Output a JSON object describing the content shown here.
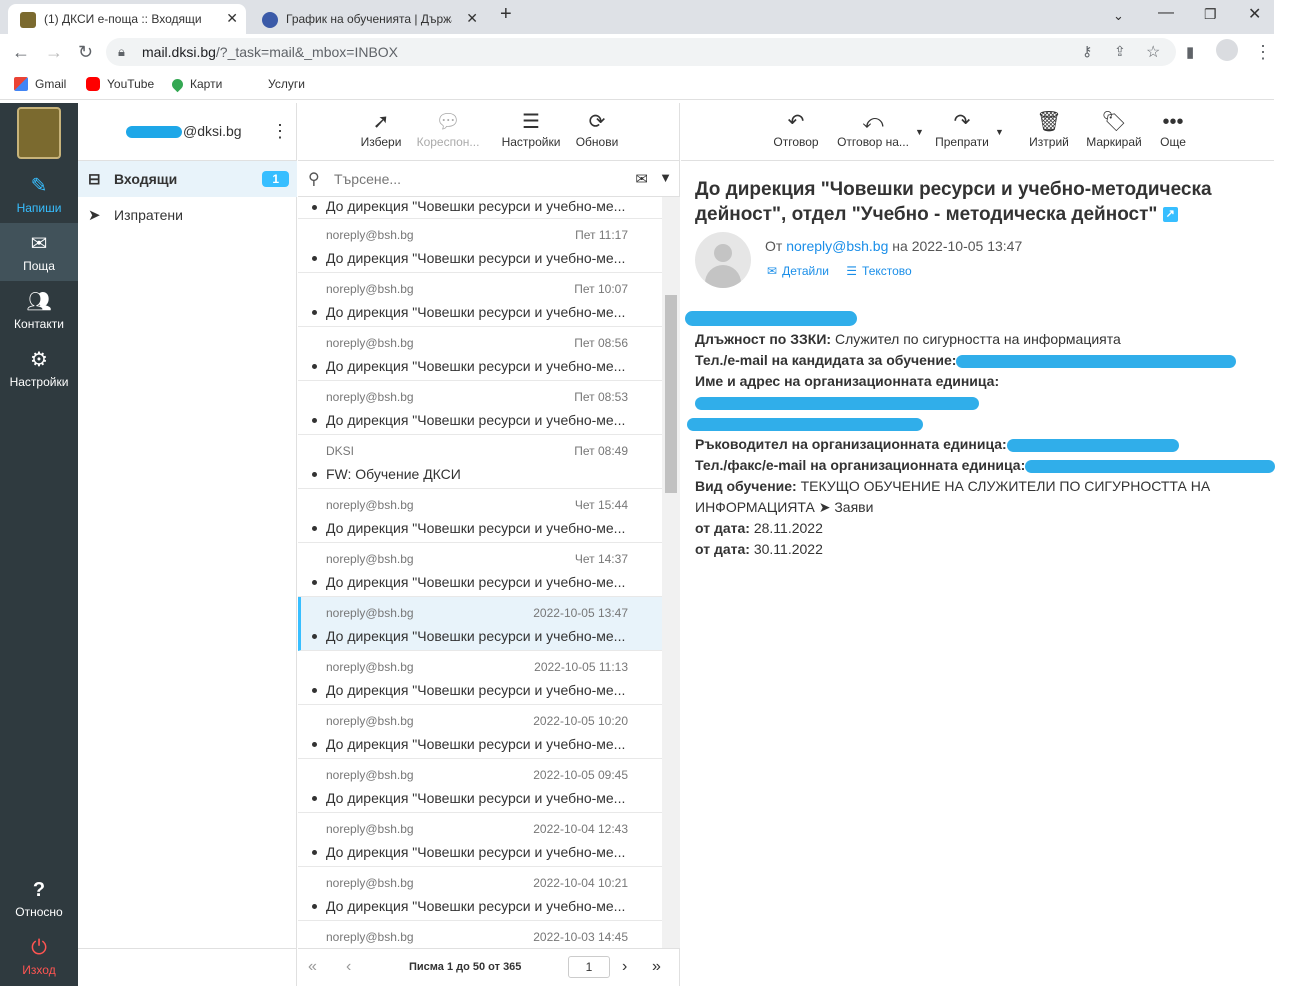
{
  "browser": {
    "tabs": [
      {
        "title": "(1) ДКСИ е-поща :: Входящи",
        "active": true
      },
      {
        "title": "График на обученията | Държав",
        "active": false
      }
    ],
    "new_tab": "+",
    "url_host": "mail.dksi.bg",
    "url_path": "/?_task=mail&_mbox=INBOX",
    "bookmarks": [
      "Gmail",
      "YouTube",
      "Карти",
      "Услуги"
    ]
  },
  "nav": {
    "compose": "Напиши",
    "mail": "Поща",
    "contacts": "Контакти",
    "settings": "Настройки",
    "about": "Относно",
    "logout": "Изход"
  },
  "folders": {
    "user_suffix": "@dksi.bg",
    "items": [
      {
        "label": "Входящи",
        "badge": "1"
      },
      {
        "label": "Изпратени"
      }
    ]
  },
  "list_toolbar": {
    "select": "Избери",
    "threads": "Кореспон...",
    "options": "Настройки",
    "refresh": "Обнови"
  },
  "search": {
    "placeholder": "Търсене..."
  },
  "messages_first_subject": "До дирекция \"Човешки ресурси и учебно-ме...",
  "messages": [
    {
      "from": "noreply@bsh.bg",
      "date": "Пет 11:17",
      "subject": "До дирекция \"Човешки ресурси и учебно-ме..."
    },
    {
      "from": "noreply@bsh.bg",
      "date": "Пет 10:07",
      "subject": "До дирекция \"Човешки ресурси и учебно-ме..."
    },
    {
      "from": "noreply@bsh.bg",
      "date": "Пет 08:56",
      "subject": "До дирекция \"Човешки ресурси и учебно-ме..."
    },
    {
      "from": "noreply@bsh.bg",
      "date": "Пет 08:53",
      "subject": "До дирекция \"Човешки ресурси и учебно-ме..."
    },
    {
      "from": "DKSI",
      "date": "Пет 08:49",
      "subject": "FW: Обучение ДКСИ"
    },
    {
      "from": "noreply@bsh.bg",
      "date": "Чет 15:44",
      "subject": "До дирекция \"Човешки ресурси и учебно-ме..."
    },
    {
      "from": "noreply@bsh.bg",
      "date": "Чет 14:37",
      "subject": "До дирекция \"Човешки ресурси и учебно-ме..."
    },
    {
      "from": "noreply@bsh.bg",
      "date": "2022-10-05 13:47",
      "subject": "До дирекция \"Човешки ресурси и учебно-ме...",
      "selected": true
    },
    {
      "from": "noreply@bsh.bg",
      "date": "2022-10-05 11:13",
      "subject": "До дирекция \"Човешки ресурси и учебно-ме..."
    },
    {
      "from": "noreply@bsh.bg",
      "date": "2022-10-05 10:20",
      "subject": "До дирекция \"Човешки ресурси и учебно-ме..."
    },
    {
      "from": "noreply@bsh.bg",
      "date": "2022-10-05 09:45",
      "subject": "До дирекция \"Човешки ресурси и учебно-ме..."
    },
    {
      "from": "noreply@bsh.bg",
      "date": "2022-10-04 12:43",
      "subject": "До дирекция \"Човешки ресурси и учебно-ме..."
    },
    {
      "from": "noreply@bsh.bg",
      "date": "2022-10-04 10:21",
      "subject": "До дирекция \"Човешки ресурси и учебно-ме..."
    },
    {
      "from": "noreply@bsh.bg",
      "date": "2022-10-03 14:45",
      "subject": ""
    }
  ],
  "pagination": {
    "count": "Писма 1 до 50 от 365",
    "page": "1"
  },
  "reader_toolbar": {
    "reply": "Отговор",
    "reply_all": "Отговор на...",
    "forward": "Препрати",
    "delete": "Изтрий",
    "mark": "Маркирай",
    "more": "Още"
  },
  "email": {
    "subject": "До дирекция \"Човешки ресурси и учебно-методическа дейност\", отдел \"Учебно - методическа дейност\"",
    "from_prefix": "От",
    "from": "noreply@bsh.bg",
    "date_prefix": "на",
    "date": "2022-10-05 13:47",
    "details": "Детайли",
    "plaintext": "Текстово",
    "position_label": "Длъжност по ЗЗКИ:",
    "position_value": "Служител по сигурността на информацията",
    "phone_label": "Тел./e-mail на кандидата за обучение:",
    "org_label": "Име и адрес на организационната единица:",
    "head_label": "Ръководител на организационната единица:",
    "fax_label": "Тел./факс/e-mail на организационната единица:",
    "training_label": "Вид обучение:",
    "training_value": "ТЕКУЩО ОБУЧЕНИЕ НА СЛУЖИТЕЛИ ПО СИГУРНОСТТА НА ИНФОРМАЦИЯТА ➤ Заяви",
    "from_date_label": "от дата:",
    "from_date_value": "28.11.2022",
    "to_date_label": "от дата:",
    "to_date_value": "30.11.2022"
  }
}
